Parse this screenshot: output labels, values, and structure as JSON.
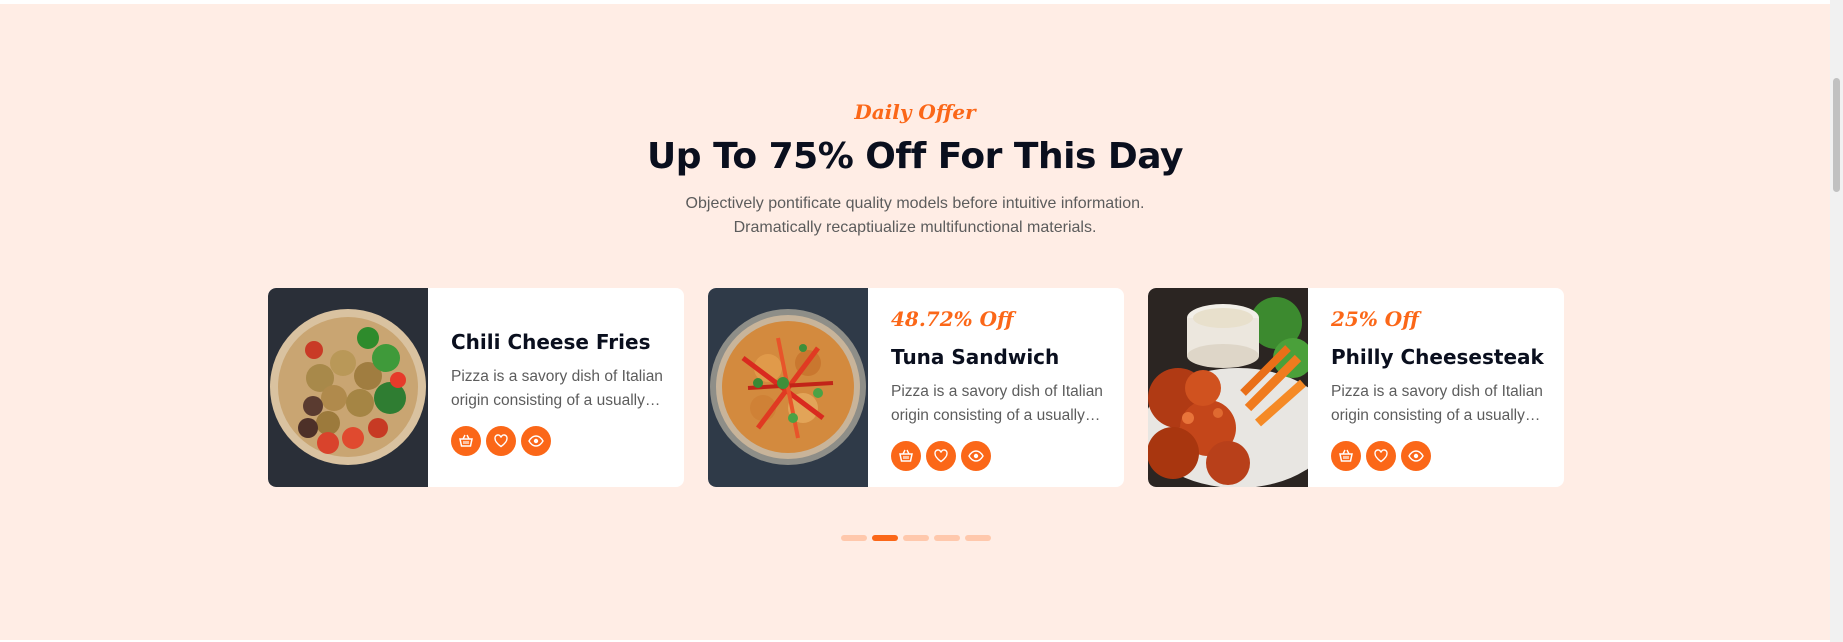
{
  "section": {
    "eyebrow": "Daily Offer",
    "title": "Up To 75% Off For This Day",
    "description": [
      "Objectively pontificate quality models before intuitive information.",
      "Dramatically recaptiualize multifunctional materials."
    ]
  },
  "cards": [
    {
      "discount": "",
      "name": "Chili Cheese Fries",
      "text": "Pizza is a savory dish of Italian origin consisting of a usually round, flattened base of leavened wheat-based dough.",
      "image": "chicken-bowl-photo"
    },
    {
      "discount": "48.72% Off",
      "name": "Tuna Sandwich",
      "text": "Pizza is a savory dish of Italian origin consisting of a usually round, flattened base of leavened wheat-based dough.",
      "image": "stir-fry-plate-photo"
    },
    {
      "discount": "25% Off",
      "name": "Philly Cheesesteak",
      "text": "Pizza is a savory dish of Italian origin consisting of a usually round, flattened base of leavened wheat-based dough.",
      "image": "fried-chicken-photo"
    }
  ],
  "card_actions": [
    "basket-icon",
    "heart-icon",
    "eye-icon"
  ],
  "pagination": {
    "count": 5,
    "active_index": 1
  },
  "colors": {
    "accent": "#fb6718",
    "section_bg": "#ffede5",
    "heading": "#0a0f1e",
    "dot_inactive": "#ffc8ac"
  }
}
